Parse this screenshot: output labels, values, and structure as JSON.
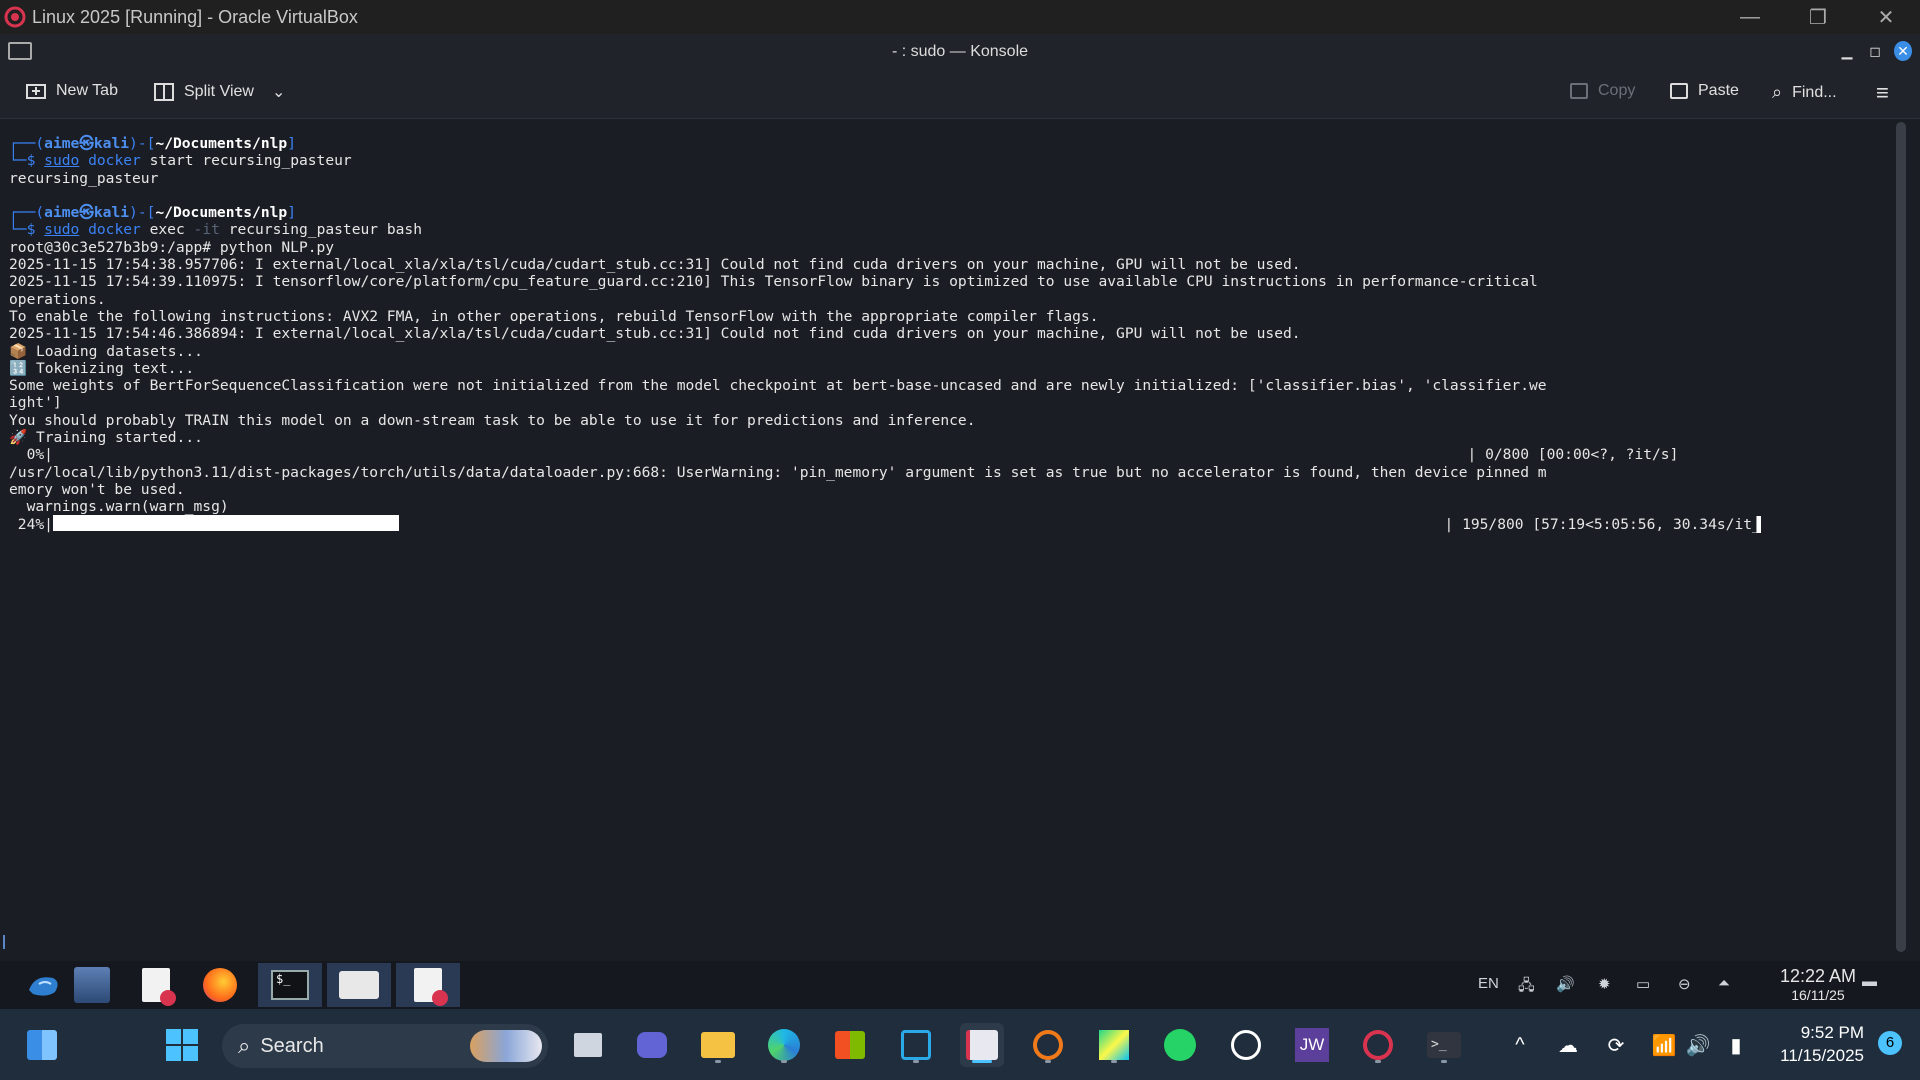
{
  "vbox": {
    "title": "Linux 2025 [Running] - Oracle VirtualBox",
    "minimize": "—",
    "restore": "❐",
    "close": "✕"
  },
  "konsole": {
    "title": "- : sudo — Konsole",
    "toolbar": {
      "new_tab": "New Tab",
      "split_view": "Split View",
      "copy": "Copy",
      "paste": "Paste",
      "find": "Find..."
    }
  },
  "terminal": {
    "prompt_user": "aime㉿kali",
    "prompt_path": "~/Documents/nlp",
    "cmd1_rest": "start recursing_pasteur",
    "out1": "recursing_pasteur",
    "cmd2_rest": "recursing_pasteur bash",
    "root_line": "root@30c3e527b3b9:/app# python NLP.py",
    "log1": "2025-11-15 17:54:38.957706: I external/local_xla/xla/tsl/cuda/cudart_stub.cc:31] Could not find cuda drivers on your machine, GPU will not be used.",
    "log2a": "2025-11-15 17:54:39.110975: I tensorflow/core/platform/cpu_feature_guard.cc:210] This TensorFlow binary is optimized to use available CPU instructions in performance-critical",
    "log2b": "operations.",
    "log3": "To enable the following instructions: AVX2 FMA, in other operations, rebuild TensorFlow with the appropriate compiler flags.",
    "log4": "2025-11-15 17:54:46.386894: I external/local_xla/xla/tsl/cuda/cudart_stub.cc:31] Could not find cuda drivers on your machine, GPU will not be used.",
    "loading": "📦 Loading datasets...",
    "tokenizing": "🔢 Tokenizing text...",
    "warn1a": "Some weights of BertForSequenceClassification were not initialized from the model checkpoint at bert-base-uncased and are newly initialized: ['classifier.bias', 'classifier.we",
    "warn1b": "ight']",
    "warn2": "You should probably TRAIN this model on a down-stream task to be able to use it for predictions and inference.",
    "training": "🚀 Training started...",
    "p0_left": "  0%|",
    "p0_right": "| 0/800 [00:00<?, ?it/s]",
    "user_warn_a": "/usr/local/lib/python3.11/dist-packages/torch/utils/data/dataloader.py:668: UserWarning: 'pin_memory' argument is set as true but no accelerator is found, then device pinned m",
    "user_warn_b": "emory won't be used.",
    "warn_call": "  warnings.warn(warn_msg)",
    "p1_left": " 24%|",
    "p1_right": "| 195/800 [57:19<5:05:56, 30.34s/it",
    "progress_fraction": 0.24
  },
  "guest_panel": {
    "lang": "EN",
    "time": "12:22 AM",
    "date": "16/11/25"
  },
  "windows_taskbar": {
    "search_label": "Search",
    "time": "9:52 PM",
    "date": "11/15/2025",
    "notification_count": "6"
  }
}
